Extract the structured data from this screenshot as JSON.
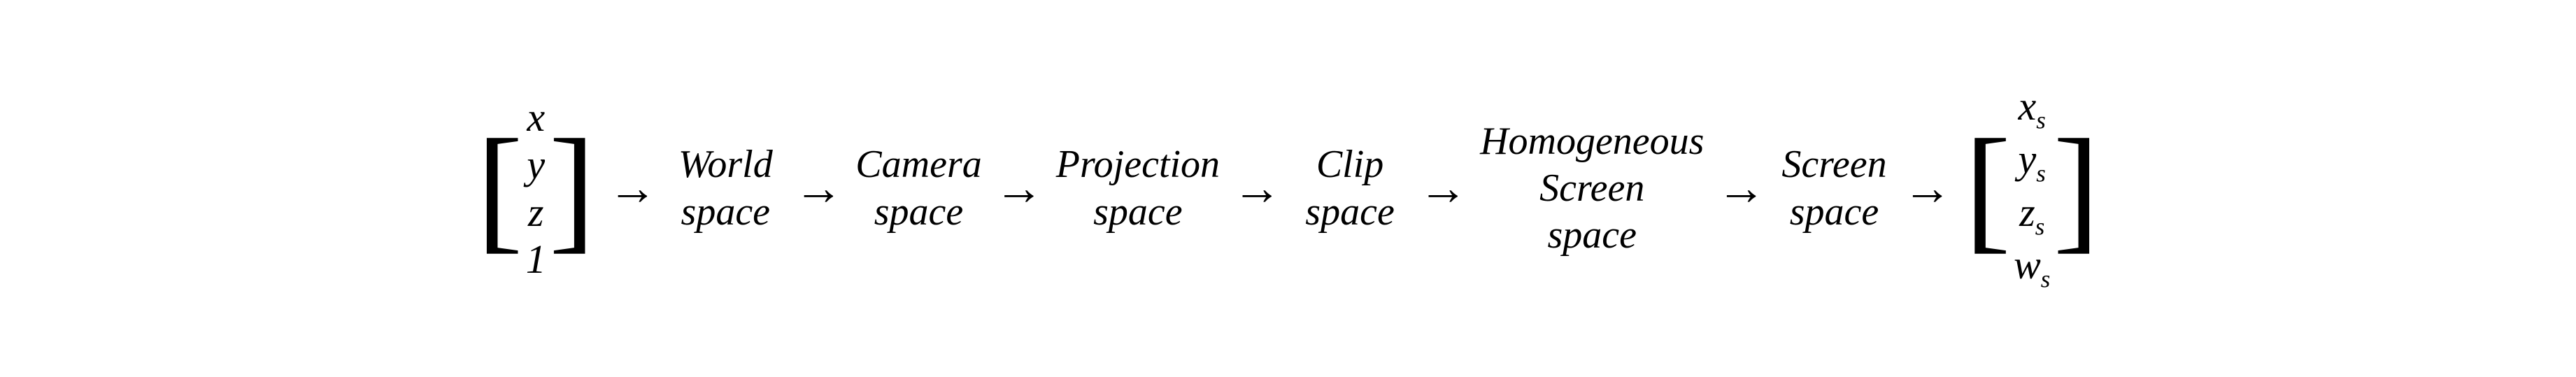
{
  "pipeline": {
    "input_matrix": {
      "entries": [
        "x",
        "y",
        "z",
        "1"
      ],
      "bracket_left": "[",
      "bracket_right": "]"
    },
    "output_matrix": {
      "entries": [
        "x_s",
        "y_s",
        "z_s",
        "w_s"
      ],
      "subscripts": [
        "s",
        "s",
        "s",
        "s"
      ]
    },
    "stages": [
      {
        "label": "World",
        "label2": "space"
      },
      {
        "label": "Camera",
        "label2": "space"
      },
      {
        "label": "Projection",
        "label2": "space"
      },
      {
        "label": "Clip",
        "label2": "space"
      },
      {
        "label": "Homogeneous",
        "label2": "Screen",
        "label3": "space"
      },
      {
        "label": "Screen",
        "label2": "space"
      }
    ],
    "arrow": "→"
  }
}
